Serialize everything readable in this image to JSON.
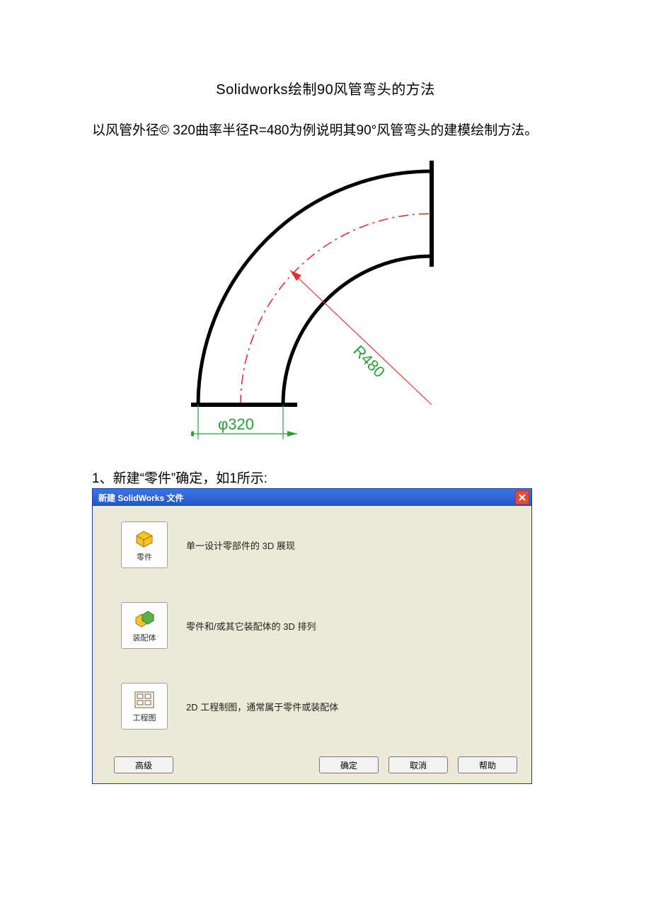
{
  "doc": {
    "title": "Solidworks绘制90风管弯头的方法",
    "intro": "以风管外径© 320曲率半径R=480为例说明其90°风管弯头的建模绘制方法。",
    "step1": "1、新建“零件”确定，如1所示:"
  },
  "diagram": {
    "diameter_label": "φ320",
    "radius_label": "R480"
  },
  "dialog": {
    "title": "新建 SolidWorks 文件",
    "options": [
      {
        "id": "part",
        "label": "零件",
        "desc": "单一设计零部件的 3D 展现",
        "iconColor": "#f4c22b"
      },
      {
        "id": "assembly",
        "label": "装配体",
        "desc": "零件和/或其它装配体的 3D 排列",
        "iconColor": "#5cb04a"
      },
      {
        "id": "drawing",
        "label": "工程图",
        "desc": "2D 工程制图，通常属于零件或装配体",
        "iconColor": "#d8a24d"
      }
    ],
    "buttons": {
      "advanced": "高级",
      "ok": "确定",
      "cancel": "取消",
      "help": "帮助"
    }
  }
}
